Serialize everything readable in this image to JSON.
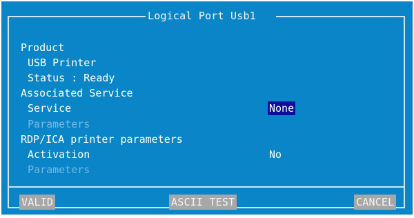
{
  "dialog": {
    "title": "Logical Port Usb1"
  },
  "product": {
    "heading": "Product",
    "name": "USB Printer",
    "status": "Status : Ready"
  },
  "associated_service": {
    "heading": "Associated Service",
    "service_label": "Service",
    "service_value": "None",
    "parameters_label": "Parameters"
  },
  "rdp_ica": {
    "heading": "RDP/ICA printer parameters",
    "activation_label": "Activation",
    "activation_value": "No",
    "parameters_label": "Parameters"
  },
  "buttons": {
    "valid": "VALID",
    "ascii_test": "ASCII TEST",
    "cancel": "CANCEL"
  },
  "colors": {
    "background": "#0a86c8",
    "border": "#cfe6f7",
    "selection": "#0b0f9c",
    "disabled_text": "#74b8e5",
    "button": "#a7a7a7"
  }
}
